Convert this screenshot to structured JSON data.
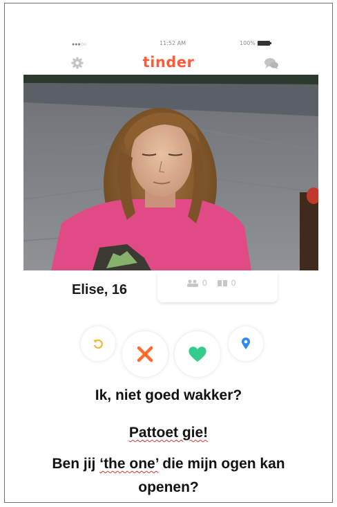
{
  "status_bar": {
    "signal": "●●●○○",
    "time": "11:52 AM",
    "battery": "100%"
  },
  "header": {
    "logo": "tinder"
  },
  "profile": {
    "name": "Elise, 16",
    "friends_count": "0",
    "interests_count": "0"
  },
  "actions": {
    "undo": "undo",
    "nope": "nope",
    "like": "like",
    "boost": "boost"
  },
  "caption": {
    "line1": "Ik, niet goed wakker?",
    "line2": "Pattoet gie!",
    "line3a": "Ben jij ",
    "line3b": "‘the one’",
    "line3c": " die mijn ogen kan",
    "line3d": "openen?"
  },
  "colors": {
    "brand": "#ff5a3a",
    "nope": "#ff6a33",
    "like": "#33cc8c",
    "undo": "#f5b631",
    "boost": "#2c8cf0"
  }
}
